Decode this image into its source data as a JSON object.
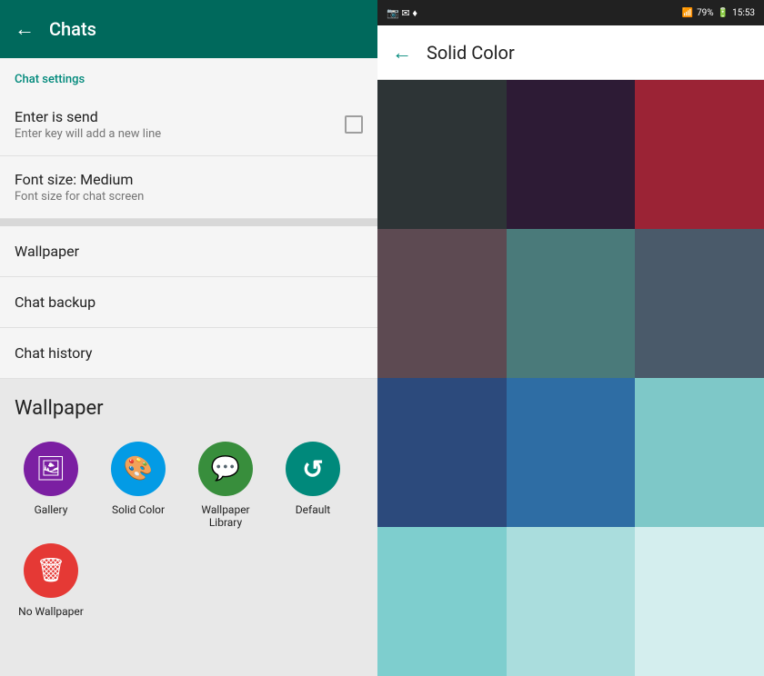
{
  "left": {
    "header": {
      "back_icon": "←",
      "title": "Chats"
    },
    "section_label": "Chat settings",
    "items": [
      {
        "id": "enter-is-send",
        "title": "Enter is send",
        "subtitle": "Enter key will add a new line",
        "has_checkbox": true
      },
      {
        "id": "font-size",
        "title": "Font size: Medium",
        "subtitle": "Font size for chat screen",
        "has_checkbox": false
      }
    ],
    "simple_items": [
      {
        "id": "wallpaper",
        "title": "Wallpaper"
      },
      {
        "id": "chat-backup",
        "title": "Chat backup"
      },
      {
        "id": "chat-history",
        "title": "Chat history"
      }
    ],
    "wallpaper_section": {
      "title": "Wallpaper",
      "options": [
        {
          "id": "gallery",
          "label": "Gallery",
          "icon_class": "icon-gallery",
          "icon": "🖼"
        },
        {
          "id": "solid-color",
          "label": "Solid Color",
          "icon_class": "icon-solid",
          "icon": "🎨"
        },
        {
          "id": "wallpaper-library",
          "label": "Wallpaper Library",
          "icon_class": "icon-library",
          "icon": "💬"
        },
        {
          "id": "default",
          "label": "Default",
          "icon_class": "icon-default",
          "icon": "↺"
        },
        {
          "id": "no-wallpaper",
          "label": "No Wallpaper",
          "icon_class": "icon-nowallpaper",
          "icon": "🗑"
        }
      ]
    }
  },
  "right": {
    "status_bar": {
      "left_icons": "📷 ✉ ♦",
      "wifi": "WiFi",
      "signal": "79%",
      "battery": "🔋",
      "time": "15:53"
    },
    "header": {
      "back_icon": "←",
      "title": "Solid Color"
    },
    "colors": [
      "#2d3436",
      "#2d1b35",
      "#9b2335",
      "#5d4a52",
      "#4a7a7a",
      "#4a5a6a",
      "#2c4a7c",
      "#2e6da4",
      "#7ec8c8",
      "#7ecece",
      "#aadddd",
      "#d4eeee"
    ]
  }
}
